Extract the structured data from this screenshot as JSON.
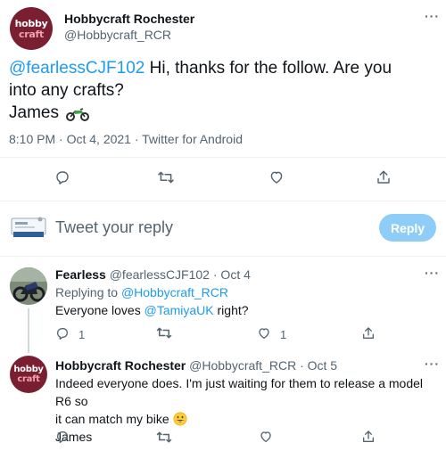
{
  "main_tweet": {
    "author_name": "Hobbycraft Rochester",
    "author_handle": "@Hobbycraft_RCR",
    "avatar_line1": "hobby",
    "avatar_line2": "craft",
    "more": "···",
    "mention": "@fearlessCJF102",
    "text_line1": " Hi, thanks for the follow. Are you",
    "text_line2": "into any crafts?",
    "text_line3": "James",
    "timestamp": "8:10 PM · Oct 4, 2021 · Twitter for Android"
  },
  "compose": {
    "placeholder": "Tweet your reply",
    "reply_button": "Reply"
  },
  "replies": [
    {
      "name": "Fearless",
      "handle": "@fearlessCJF102",
      "date": "· Oct 4",
      "replying_prefix": "Replying to ",
      "replying_to": "@Hobbycraft_RCR",
      "text_before": "Everyone loves ",
      "text_mention": "@TamiyaUK",
      "text_after": " right?",
      "reply_count": "1",
      "like_count": "1"
    },
    {
      "name": "Hobbycraft Rochester",
      "handle": "@Hobbycraft_RCR",
      "date": "· Oct 5",
      "avatar_line1": "hobby",
      "avatar_line2": "craft",
      "text_line1": "Indeed everyone does. I'm just waiting for them to release a model R6 so",
      "text_line2": "it can match my bike ",
      "text_line3": "James"
    }
  ],
  "colors": {
    "accent": "#1d9bf0",
    "reply_button": "#8ecdf8",
    "brand_avatar": "#7a1f32"
  }
}
